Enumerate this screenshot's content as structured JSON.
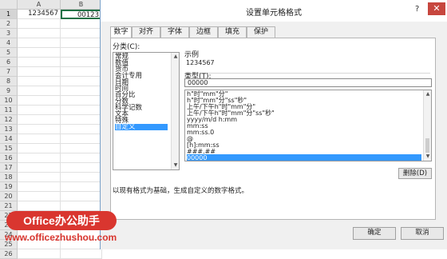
{
  "sheet": {
    "columns": [
      "A",
      "B"
    ],
    "rows": [
      "1",
      "2",
      "3",
      "4",
      "5",
      "6",
      "7",
      "8",
      "9",
      "10",
      "11",
      "12",
      "13",
      "14",
      "15",
      "16",
      "17",
      "18",
      "19",
      "20",
      "21",
      "22",
      "23",
      "24",
      "25",
      "26"
    ],
    "cells": {
      "a1": "1234567",
      "b1": "00123"
    }
  },
  "dialog": {
    "title": "设置单元格格式",
    "help": "?",
    "close": "✕",
    "tabs": [
      "数字",
      "对齐",
      "字体",
      "边框",
      "填充",
      "保护"
    ],
    "category_label": "分类(C):",
    "categories": [
      "常规",
      "数值",
      "货币",
      "会计专用",
      "日期",
      "时间",
      "百分比",
      "分数",
      "科学记数",
      "文本",
      "特殊",
      "自定义"
    ],
    "selected_category": "自定义",
    "sample_label": "示例",
    "sample_value": "1234567",
    "type_label": "类型(T):",
    "type_value": "00000",
    "formats": [
      "h\"时\"mm\"分\"",
      "h\"时\"mm\"分\"ss\"秒\"",
      "上午/下午h\"时\"mm\"分\"",
      "上午/下午h\"时\"mm\"分\"ss\"秒\"",
      "yyyy/m/d h:mm",
      "mm:ss",
      "mm:ss.0",
      "@",
      "[h]:mm:ss",
      "###.##",
      "00000"
    ],
    "selected_format": "00000",
    "delete_button": "删除(D)",
    "description": "以现有格式为基础，生成自定义的数字格式。",
    "ok_button": "确定",
    "cancel_button": "取消"
  },
  "watermark": {
    "badge": "Office办公助手",
    "url": "www.officezhushou.com"
  }
}
